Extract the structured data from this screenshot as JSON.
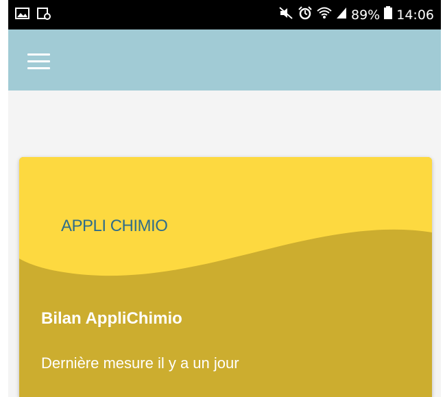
{
  "status_bar": {
    "battery_percent": "89%",
    "time": "14:06",
    "left_icons": [
      "image-icon",
      "screenshot-icon"
    ],
    "right_icons": [
      "mute-icon",
      "alarm-icon",
      "wifi-icon",
      "signal-icon",
      "battery-icon"
    ]
  },
  "app_bar": {
    "menu_icon": "hamburger-menu-icon"
  },
  "card": {
    "logo_text": "APPLI CHIMIO",
    "title": "Bilan AppliChimio",
    "subtitle": "Dernière mesure il y a un jour"
  },
  "colors": {
    "status_bar_bg": "#000000",
    "app_bar_bg": "#a1cbd5",
    "page_bg": "#f4f4f4",
    "card_top_yellow": "#fdd940",
    "card_bottom_mustard": "#ccad2f",
    "logo_text": "#2f6d8a"
  }
}
